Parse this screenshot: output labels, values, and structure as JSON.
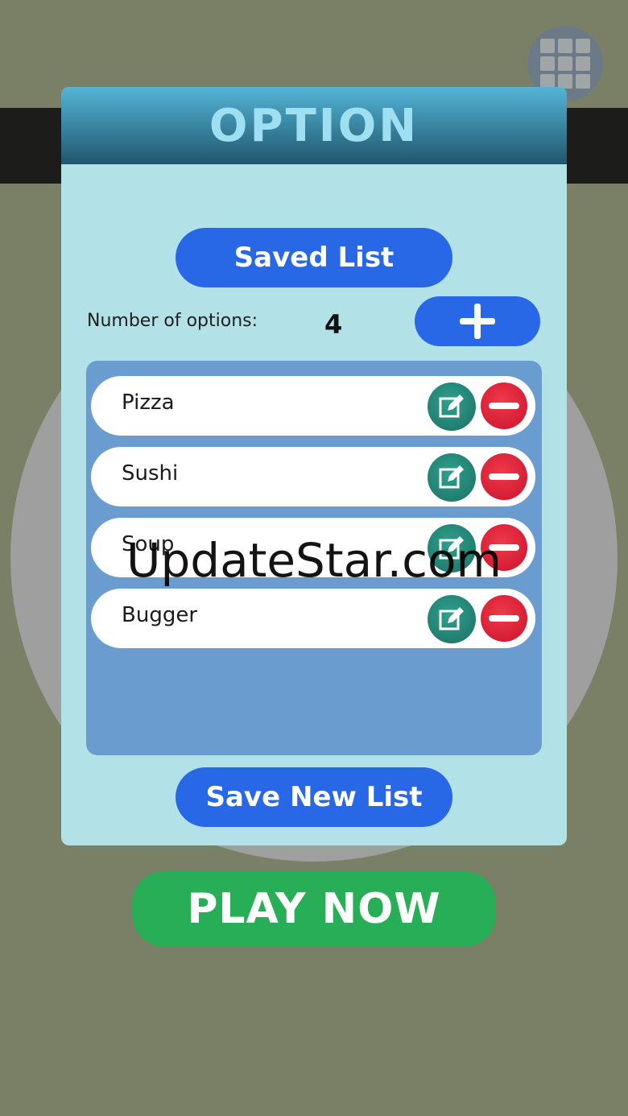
{
  "menu": {
    "icon": "grid-icon"
  },
  "dialog": {
    "title": "OPTION",
    "saved_list_label": "Saved List",
    "count_label": "Number of options:",
    "count_value": "4",
    "add_icon": "plus-icon",
    "items": [
      {
        "label": "Pizza"
      },
      {
        "label": "Sushi"
      },
      {
        "label": "Soup"
      },
      {
        "label": "Bugger"
      }
    ],
    "edit_icon": "edit-icon",
    "delete_icon": "minus-circle-icon",
    "save_new_label": "Save New List"
  },
  "play_label": "PLAY NOW",
  "watermark": "UpdateStar.com",
  "colors": {
    "background": "#7a8066",
    "panel": "#b2e2e8",
    "primary_button": "#2868e6",
    "play_button": "#27ae57",
    "edit_button": "#1f7f70",
    "delete_button": "#e0203a"
  }
}
